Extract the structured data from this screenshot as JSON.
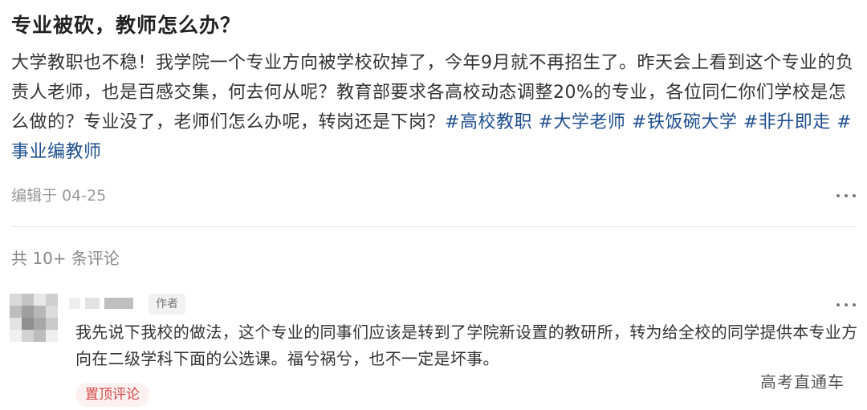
{
  "post": {
    "title": "专业被砍，教师怎么办？",
    "body": "大学教职也不稳！我学院一个专业方向被学校砍掉了，今年9月就不再招生了。昨天会上看到这个专业的负责人老师，也是百感交集，何去何从呢？教育部要求各高校动态调整20%的专业，各位同仁你们学校是怎么做的？专业没了，老师们怎么办呢，转岗还是下岗？",
    "hashtags": [
      "#高校教职",
      "#大学老师",
      "#铁饭碗大学",
      "#非升即走",
      "#事业编教师"
    ],
    "edit_time": "编辑于 04-25",
    "more_icon": "more-dots-icon"
  },
  "comments_header": "共 10+ 条评论",
  "comment": {
    "author_badge": "作者",
    "text": "我先说下我校的做法，这个专业的同事们应该是转到了学院新设置的教研所，转为给全校的同学提供本专业方向在二级学科下面的公选课。福兮祸兮，也不一定是坏事。",
    "pin_label": "置顶评论",
    "more_icon": "more-dots-icon"
  },
  "watermark": "高考直通车",
  "colors": {
    "hashtag": "#1f4f8f",
    "pin_text": "#d04a47",
    "pin_bg": "#fdf0f0",
    "muted": "#999999"
  }
}
